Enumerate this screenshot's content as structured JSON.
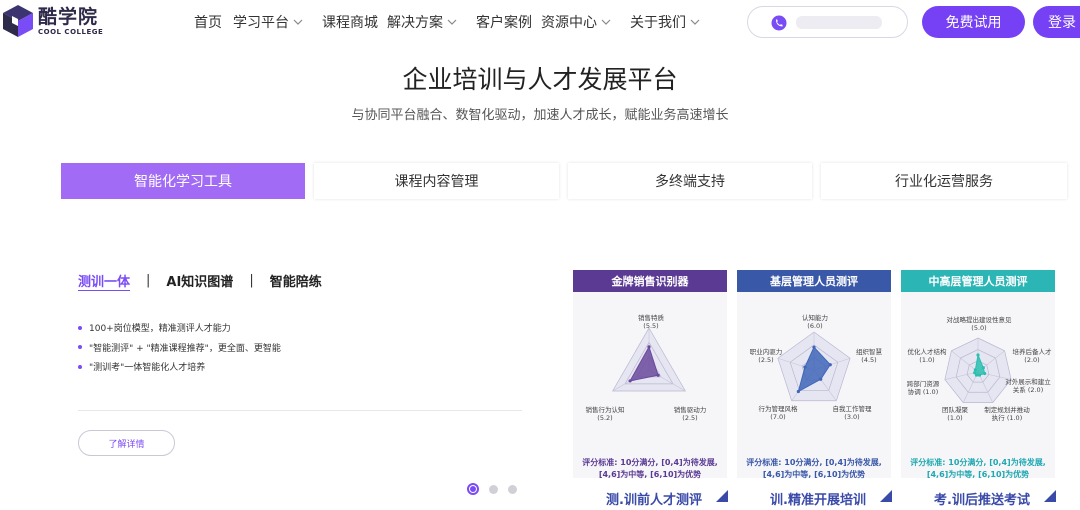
{
  "brand": {
    "name_cn": "酷学院",
    "name_en": "COOL COLLEGE",
    "color": "#2d2a4a"
  },
  "nav": [
    {
      "label": "首页",
      "dropdown": false
    },
    {
      "label": "学习平台",
      "dropdown": true
    },
    {
      "label": "课程商城",
      "dropdown": false
    },
    {
      "label": "解决方案",
      "dropdown": true
    },
    {
      "label": "客户案例",
      "dropdown": false
    },
    {
      "label": "资源中心",
      "dropdown": true
    },
    {
      "label": "关于我们",
      "dropdown": true
    }
  ],
  "header": {
    "trial_label": "免费试用",
    "login_label": "登录",
    "accent": "#7640f5",
    "phone_icon": "phone-icon"
  },
  "hero": {
    "title": "企业培训与人才发展平台",
    "subtitle": "与协同平台融合、数智化驱动，加速人才成长，赋能业务高速增长"
  },
  "tabs": [
    {
      "label": "智能化学习工具",
      "active": true
    },
    {
      "label": "课程内容管理",
      "active": false
    },
    {
      "label": "多终端支持",
      "active": false
    },
    {
      "label": "行业化运营服务",
      "active": false
    }
  ],
  "sub_tabs": [
    {
      "label": "测训一体",
      "active": true
    },
    {
      "label": "AI知识图谱",
      "active": false
    },
    {
      "label": "智能陪练",
      "active": false
    }
  ],
  "bullets": [
    "100+岗位模型，精准测评人才能力",
    "\"智能测评\" + \"精准课程推荐\"，更全面、更智能",
    "\"测训考\"一体智能化人才培养"
  ],
  "detail_label": "了解详情",
  "pager": {
    "count": 3,
    "active": 0
  },
  "cards": [
    {
      "header": "金牌销售识别器",
      "header_color": "#5b3a93",
      "fill": "#6a4a9e",
      "labels": [
        "销售特质\n(5.5)",
        "销售驱动力\n(2.5)",
        "销售行为认知\n(5.2)"
      ],
      "values": [
        5.5,
        2.5,
        5.2
      ],
      "max": 10,
      "score_line1": "评分标准: 10分满分, [0,4]为待发展,",
      "score_line2": "[4,6]为中等, [6,10]为优势",
      "score_color": "#5b3a93",
      "caption": "测.训前人才测评"
    },
    {
      "header": "基层管理人员测评",
      "header_color": "#3a58a8",
      "fill": "#3f66b8",
      "labels": [
        "认知能力\n(6.0)",
        "组织智慧\n(4.5)",
        "自我工作管理\n(3.0)",
        "行为管理风格\n(7.0)",
        "职业内驱力\n(2.5)"
      ],
      "values": [
        6.0,
        4.5,
        3.0,
        7.0,
        2.5
      ],
      "max": 10,
      "score_line1": "评分标准: 10分满分, [0,4]为待发展,",
      "score_line2": "[4,6]为中等, [6,10]为优势",
      "score_color": "#3a58a8",
      "caption": "训.精准开展培训"
    },
    {
      "header": "中高层管理人员测评",
      "header_color": "#2bb5b5",
      "fill": "#2bbfb0",
      "labels": [
        "对战略提出建设性意见\n(5.0)",
        "培养后备人才\n(2.0)",
        "对外展示和建立\n关系 (2.0)",
        "制定规划并推动\n执行 (1.0)",
        "团队凝聚\n(1.0)",
        "跨部门资源\n协调 (1.0)",
        "优化人才结构\n(1.0)"
      ],
      "values": [
        5.0,
        2.0,
        2.0,
        1.0,
        1.0,
        1.0,
        1.0
      ],
      "max": 10,
      "score_line1": "评分标准: 10分满分, [0,4]为待发展,",
      "score_line2": "[4,6]为中等, [6,10]为优势",
      "score_color": "#1fa8b0",
      "caption": "考.训后推送考试"
    }
  ]
}
